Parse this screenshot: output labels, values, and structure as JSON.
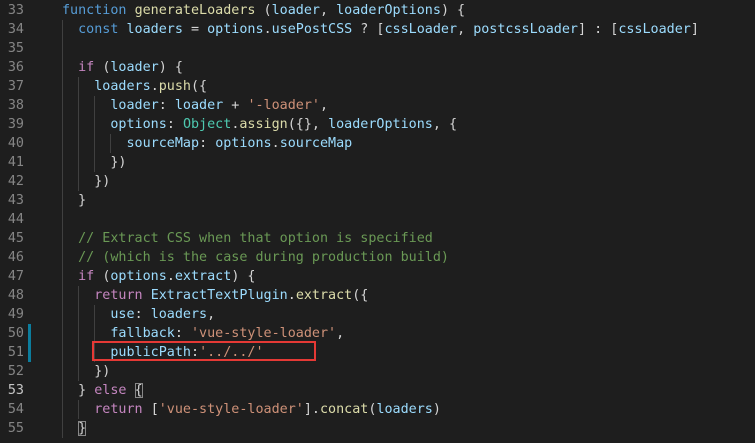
{
  "editor": {
    "lines": [
      {
        "n": "33",
        "indent": 0,
        "tokens": [
          [
            "kw",
            "function "
          ],
          [
            "fn",
            "generateLoaders"
          ],
          [
            "pun",
            " ("
          ],
          [
            "var",
            "loader"
          ],
          [
            "pun",
            ", "
          ],
          [
            "var",
            "loaderOptions"
          ],
          [
            "pun",
            ") {"
          ]
        ]
      },
      {
        "n": "34",
        "indent": 1,
        "tokens": [
          [
            "kw",
            "const "
          ],
          [
            "var",
            "loaders"
          ],
          [
            "pun",
            " = "
          ],
          [
            "var",
            "options"
          ],
          [
            "pun",
            "."
          ],
          [
            "var",
            "usePostCSS"
          ],
          [
            "pun",
            " ? ["
          ],
          [
            "var",
            "cssLoader"
          ],
          [
            "pun",
            ", "
          ],
          [
            "var",
            "postcssLoader"
          ],
          [
            "pun",
            "] : ["
          ],
          [
            "var",
            "cssLoader"
          ],
          [
            "pun",
            "]"
          ]
        ]
      },
      {
        "n": "35",
        "indent": 1,
        "tokens": []
      },
      {
        "n": "36",
        "indent": 1,
        "tokens": [
          [
            "ctrl",
            "if "
          ],
          [
            "pun",
            "("
          ],
          [
            "var",
            "loader"
          ],
          [
            "pun",
            ") {"
          ]
        ]
      },
      {
        "n": "37",
        "indent": 2,
        "tokens": [
          [
            "var",
            "loaders"
          ],
          [
            "pun",
            "."
          ],
          [
            "fn",
            "push"
          ],
          [
            "pun",
            "({"
          ]
        ]
      },
      {
        "n": "38",
        "indent": 3,
        "tokens": [
          [
            "var",
            "loader"
          ],
          [
            "pun",
            ": "
          ],
          [
            "var",
            "loader"
          ],
          [
            "pun",
            " + "
          ],
          [
            "str",
            "'-loader'"
          ],
          [
            "pun",
            ","
          ]
        ]
      },
      {
        "n": "39",
        "indent": 3,
        "tokens": [
          [
            "var",
            "options"
          ],
          [
            "pun",
            ": "
          ],
          [
            "cls",
            "Object"
          ],
          [
            "pun",
            "."
          ],
          [
            "fn",
            "assign"
          ],
          [
            "pun",
            "({}, "
          ],
          [
            "var",
            "loaderOptions"
          ],
          [
            "pun",
            ", {"
          ]
        ]
      },
      {
        "n": "40",
        "indent": 4,
        "tokens": [
          [
            "var",
            "sourceMap"
          ],
          [
            "pun",
            ": "
          ],
          [
            "var",
            "options"
          ],
          [
            "pun",
            "."
          ],
          [
            "var",
            "sourceMap"
          ]
        ]
      },
      {
        "n": "41",
        "indent": 3,
        "tokens": [
          [
            "pun",
            "})"
          ]
        ]
      },
      {
        "n": "42",
        "indent": 2,
        "tokens": [
          [
            "pun",
            "})"
          ]
        ]
      },
      {
        "n": "43",
        "indent": 1,
        "tokens": [
          [
            "pun",
            "}"
          ]
        ]
      },
      {
        "n": "44",
        "indent": 1,
        "tokens": []
      },
      {
        "n": "45",
        "indent": 1,
        "tokens": [
          [
            "cmt",
            "// Extract CSS when that option is specified"
          ]
        ]
      },
      {
        "n": "46",
        "indent": 1,
        "tokens": [
          [
            "cmt",
            "// (which is the case during production build)"
          ]
        ]
      },
      {
        "n": "47",
        "indent": 1,
        "tokens": [
          [
            "ctrl",
            "if "
          ],
          [
            "pun",
            "("
          ],
          [
            "var",
            "options"
          ],
          [
            "pun",
            "."
          ],
          [
            "var",
            "extract"
          ],
          [
            "pun",
            ") {"
          ]
        ]
      },
      {
        "n": "48",
        "indent": 2,
        "tokens": [
          [
            "ctrl",
            "return "
          ],
          [
            "var",
            "ExtractTextPlugin"
          ],
          [
            "pun",
            "."
          ],
          [
            "fn",
            "extract"
          ],
          [
            "pun",
            "({"
          ]
        ]
      },
      {
        "n": "49",
        "indent": 3,
        "tokens": [
          [
            "var",
            "use"
          ],
          [
            "pun",
            ": "
          ],
          [
            "var",
            "loaders"
          ],
          [
            "pun",
            ","
          ]
        ]
      },
      {
        "n": "50",
        "indent": 3,
        "modified": true,
        "tokens": [
          [
            "var",
            "fallback"
          ],
          [
            "pun",
            ": "
          ],
          [
            "str",
            "'vue-style-loader'"
          ],
          [
            "pun",
            ","
          ]
        ]
      },
      {
        "n": "51",
        "indent": 3,
        "modified": true,
        "tokens": [
          [
            "var",
            "publicPath"
          ],
          [
            "pun",
            ":"
          ],
          [
            "str",
            "'../../'"
          ]
        ]
      },
      {
        "n": "52",
        "indent": 2,
        "tokens": [
          [
            "pun",
            "})"
          ]
        ]
      },
      {
        "n": "53",
        "indent": 1,
        "active": true,
        "tokens": [
          [
            "pun",
            "} "
          ],
          [
            "ctrl",
            "else "
          ],
          [
            "pun",
            "{",
            "brm"
          ]
        ]
      },
      {
        "n": "54",
        "indent": 2,
        "tokens": [
          [
            "ctrl",
            "return "
          ],
          [
            "pun",
            "["
          ],
          [
            "str",
            "'vue-style-loader'"
          ],
          [
            "pun",
            "]."
          ],
          [
            "fn",
            "concat"
          ],
          [
            "pun",
            "("
          ],
          [
            "var",
            "loaders"
          ],
          [
            "pun",
            ")"
          ]
        ]
      },
      {
        "n": "55",
        "indent": 1,
        "tokens": [
          [
            "pun",
            "}",
            "brm"
          ]
        ]
      }
    ]
  }
}
